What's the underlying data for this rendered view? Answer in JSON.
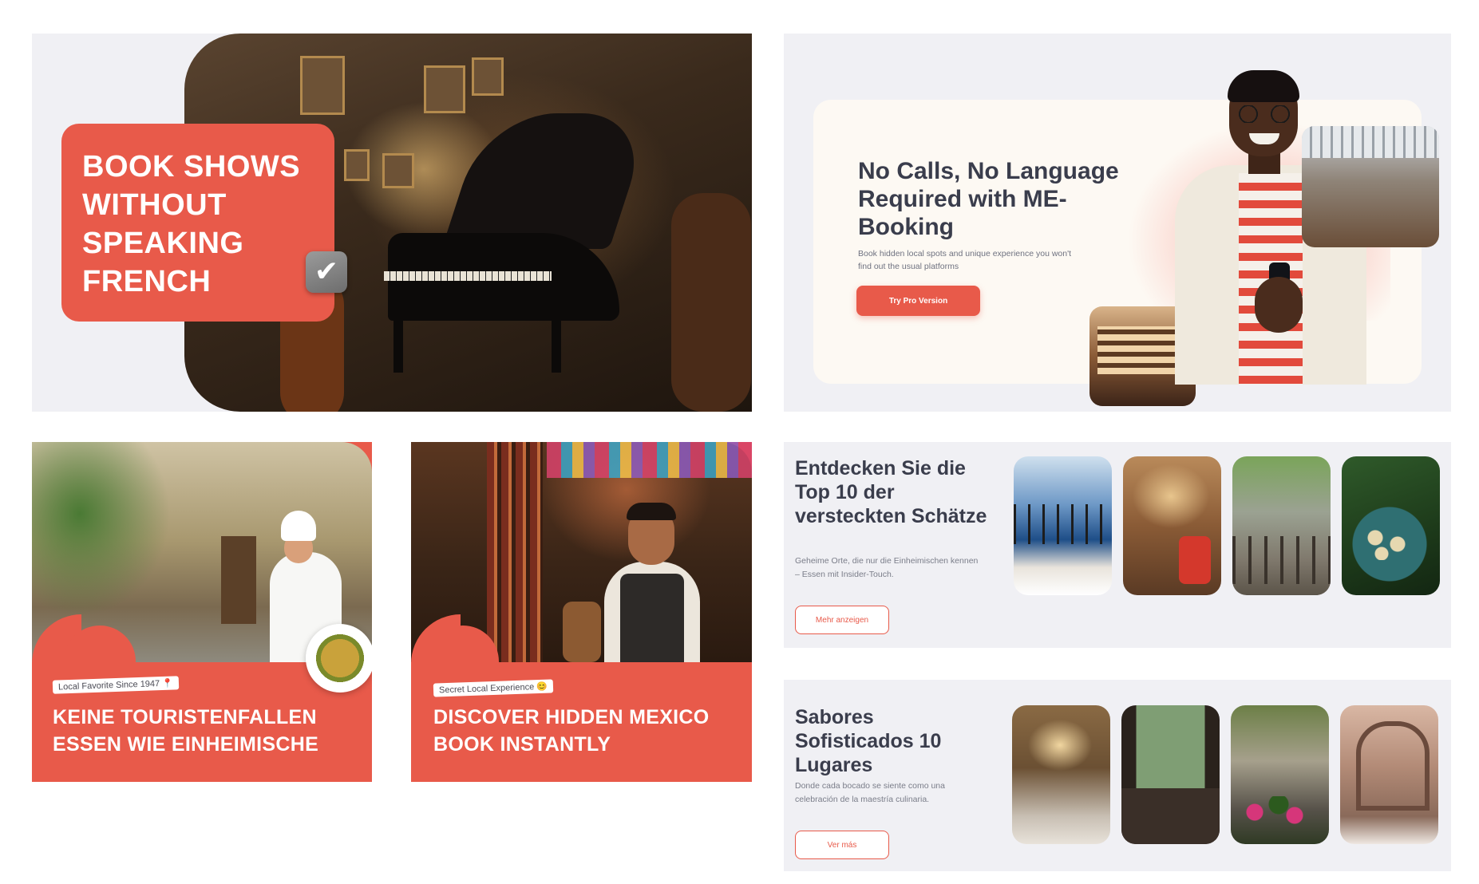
{
  "cards": {
    "shows": {
      "headline": "BOOK SHOWS WITHOUT SPEAKING FRENCH",
      "check_icon": "✔"
    },
    "nocalls": {
      "headline": "No Calls, No Language Required with ME-Booking",
      "subtitle": "Book hidden local spots and unique experience you won't find out the usual platforms",
      "cta_label": "Try Pro Version"
    },
    "keine": {
      "tag": "Local Favorite Since 1947 📍",
      "headline_line1": "KEINE TOURISTENFALLEN",
      "headline_line2": "ESSEN WIE EINHEIMISCHE"
    },
    "mexico": {
      "tag": "Secret Local Experience 😊",
      "headline_line1": "DISCOVER HIDDEN MEXICO",
      "headline_line2": "BOOK INSTANTLY"
    },
    "entdecken": {
      "title": "Entdecken Sie die Top 10 der versteckten Schätze",
      "description": "Geheime Orte, die nur die Einheimischen kennen – Essen mit Insider-Touch.",
      "button_label": "Mehr anzeigen"
    },
    "sabores": {
      "title": "Sabores Sofisticados 10 Lugares",
      "description": "Donde cada bocado se siente como una celebración de la maestría culinaria.",
      "button_label": "Ver más"
    }
  },
  "colors": {
    "accent": "#e85a4a",
    "card_bg": "#f0f0f4",
    "heading": "#3a3d4c"
  }
}
